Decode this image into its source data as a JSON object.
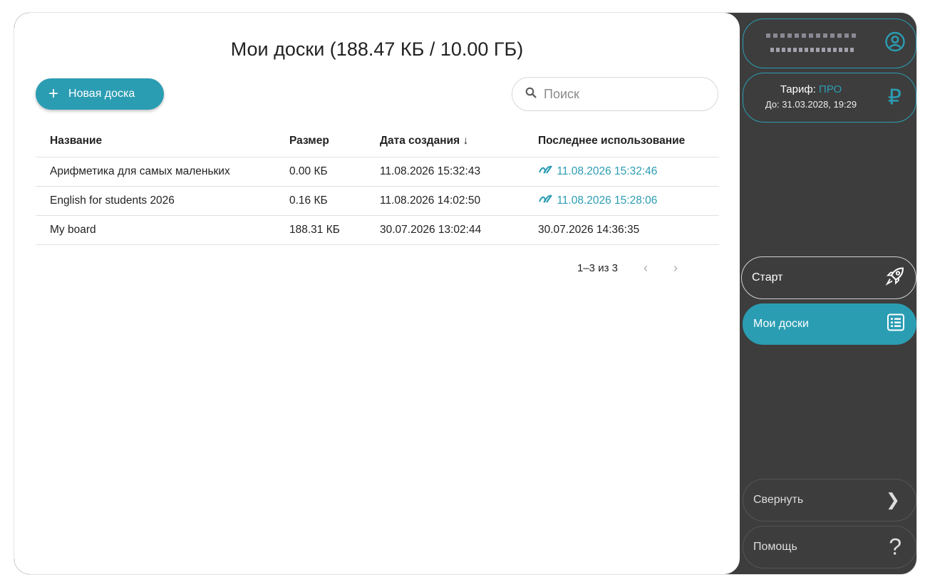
{
  "header": {
    "title": "Мои доски (188.47 КБ / 10.00 ГБ)"
  },
  "toolbar": {
    "new_board_label": "Новая доска",
    "search_placeholder": "Поиск"
  },
  "table": {
    "columns": [
      "Название",
      "Размер",
      "Дата создания ↓",
      "Последнее использование"
    ],
    "rows": [
      {
        "name": "Арифметика для самых маленьких",
        "size": "0.00 КБ",
        "created": "11.08.2026 15:32:43",
        "last_used": "11.08.2026 15:32:46",
        "linked": true
      },
      {
        "name": "English for students 2026",
        "size": "0.16 КБ",
        "created": "11.08.2026 14:02:50",
        "last_used": "11.08.2026 15:28:06",
        "linked": true
      },
      {
        "name": "My board",
        "size": "188.31 КБ",
        "created": "30.07.2026 13:02:44",
        "last_used": "30.07.2026 14:36:35",
        "linked": false
      }
    ]
  },
  "pagination": {
    "range": "1–3 из 3"
  },
  "sidebar": {
    "tariff_label": "Тариф: ",
    "tariff_value": "ПРО",
    "tariff_until": "До: 31.03.2028, 19:29",
    "start_label": "Старт",
    "boards_label": "Мои доски",
    "collapse_label": "Свернуть",
    "help_label": "Помощь"
  },
  "colors": {
    "accent": "#2b9db3",
    "sidebar_bg": "#3d3d3d"
  },
  "icons": [
    "plus-icon",
    "search-icon",
    "link-icon",
    "user-icon",
    "ruble-icon",
    "rocket-icon",
    "list-icon",
    "chevron-right-icon",
    "help-icon"
  ]
}
